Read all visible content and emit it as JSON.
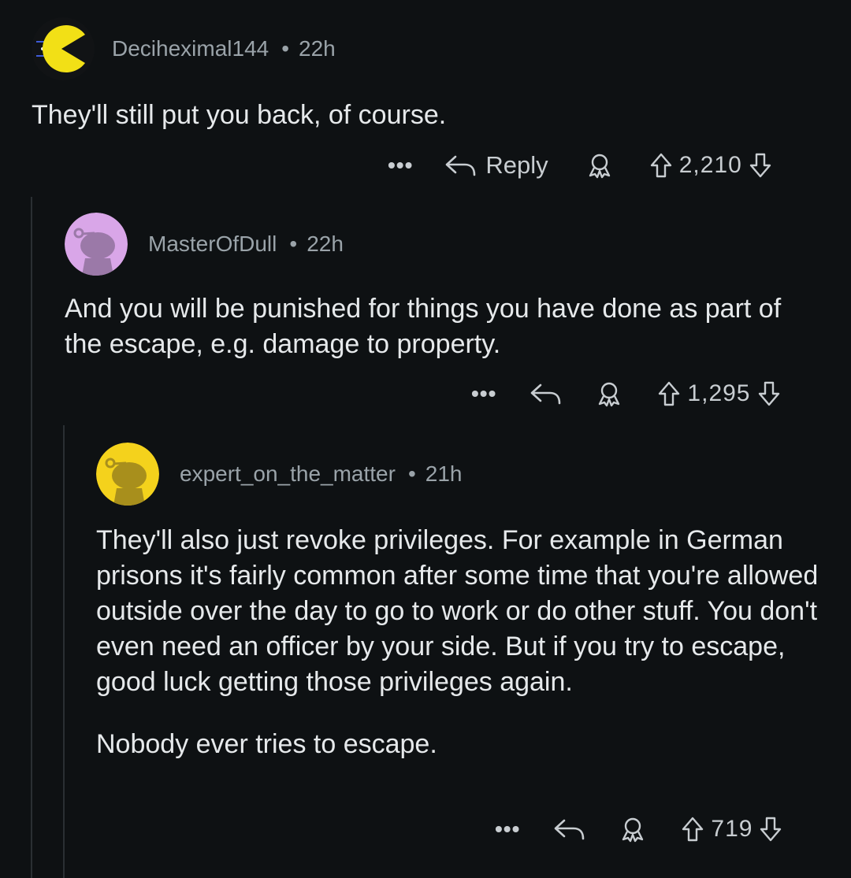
{
  "comments": [
    {
      "username": "Deciheximal144",
      "age": "22h",
      "text": "They'll still put you back, of course.",
      "reply_label": "Reply",
      "score": "2,210",
      "avatar_colors": {
        "bg": "#111315",
        "face": "#f2e016"
      }
    },
    {
      "username": "MasterOfDull",
      "age": "22h",
      "text": "And you will be punished for things you have done as part of the escape, e.g. damage to property.",
      "score": "1,295",
      "avatar_colors": {
        "bg": "#d9a6e8",
        "snoo": "#9b79a8"
      }
    },
    {
      "username": "expert_on_the_matter",
      "age": "21h",
      "paragraphs": [
        "They'll also just revoke privileges. For example in German prisons it's fairly common after some time that you're allowed outside over the day to go to work or do other stuff. You don't even need an officer by your side. But if you try to escape, good luck getting those privileges again.",
        "Nobody ever tries to escape."
      ],
      "score": "719",
      "avatar_colors": {
        "bg": "#f4d21c",
        "snoo": "#a88f1c"
      }
    }
  ],
  "separator": "•",
  "more_glyph": "•••"
}
